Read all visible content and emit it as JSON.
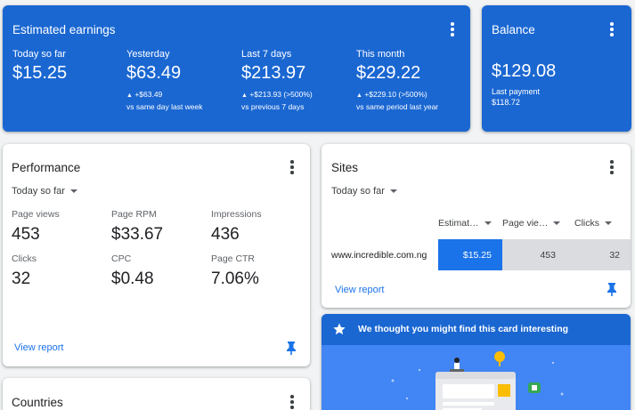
{
  "earnings": {
    "title": "Estimated earnings",
    "columns": [
      {
        "label": "Today so far",
        "value": "$15.25",
        "change": "",
        "compare": ""
      },
      {
        "label": "Yesterday",
        "value": "$63.49",
        "change": "+$63.49",
        "compare": "vs same day last week"
      },
      {
        "label": "Last 7 days",
        "value": "$213.97",
        "change": "+$213.93 (>500%)",
        "compare": "vs previous 7 days"
      },
      {
        "label": "This month",
        "value": "$229.22",
        "change": "+$229.10 (>500%)",
        "compare": "vs same period last year"
      }
    ]
  },
  "balance": {
    "title": "Balance",
    "value": "$129.08",
    "last_payment_label": "Last payment",
    "last_payment_value": "$118.72"
  },
  "performance": {
    "title": "Performance",
    "period": "Today so far",
    "metrics": [
      {
        "label": "Page views",
        "value": "453"
      },
      {
        "label": "Page RPM",
        "value": "$33.67"
      },
      {
        "label": "Impressions",
        "value": "436"
      },
      {
        "label": "Clicks",
        "value": "32"
      },
      {
        "label": "CPC",
        "value": "$0.48"
      },
      {
        "label": "Page CTR",
        "value": "7.06%"
      }
    ],
    "link": "View report"
  },
  "sites": {
    "title": "Sites",
    "period": "Today so far",
    "columns": [
      "Estimat…",
      "Page vie…",
      "Clicks"
    ],
    "row": {
      "site": "www.incredible.com.ng",
      "earnings": "$15.25",
      "page_views": "453",
      "clicks": "32"
    },
    "link": "View report"
  },
  "interesting": {
    "title": "We thought you might find this card interesting"
  },
  "countries": {
    "title": "Countries"
  },
  "colors": {
    "brand_blue": "#1a67d2",
    "link_blue": "#1a73e8",
    "bar_blue": "#1a73e8",
    "bar_grey": "#dadce0"
  }
}
